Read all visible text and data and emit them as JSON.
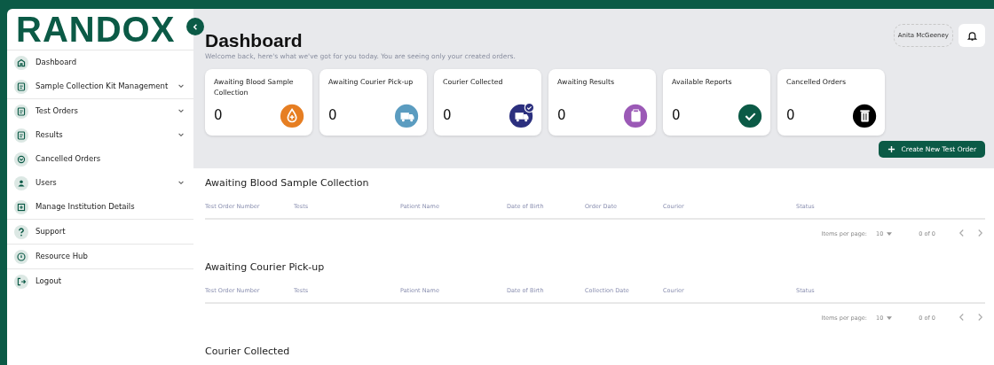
{
  "logo": {
    "text": "RANDOX"
  },
  "sidebar": {
    "items": [
      {
        "label": "Dashboard",
        "expandable": false,
        "divider": false
      },
      {
        "label": "Sample Collection Kit Management",
        "expandable": true,
        "divider": true
      },
      {
        "label": "Test Orders",
        "expandable": true,
        "divider": false
      },
      {
        "label": "Results",
        "expandable": true,
        "divider": false
      },
      {
        "label": "Cancelled Orders",
        "expandable": false,
        "divider": false
      },
      {
        "label": "Users",
        "expandable": true,
        "divider": false
      },
      {
        "label": "Manage Institution Details",
        "expandable": false,
        "divider": true
      },
      {
        "label": "Support",
        "expandable": false,
        "divider": true
      },
      {
        "label": "Resource Hub",
        "expandable": false,
        "divider": true
      },
      {
        "label": "Logout",
        "expandable": false,
        "divider": false
      }
    ]
  },
  "header": {
    "title": "Dashboard",
    "subtitle": "Welcome back, here's what we've got for you today. You are seeing only your created orders.",
    "user": "Anita McGeeney"
  },
  "cards": [
    {
      "label": "Awaiting Blood Sample Collection",
      "count": "0",
      "color": "#e67e22",
      "badge": false
    },
    {
      "label": "Awaiting Courier Pick-up",
      "count": "0",
      "color": "#5b9cc0",
      "badge": false
    },
    {
      "label": "Courier Collected",
      "count": "0",
      "color": "#2b2f7e",
      "badge": true
    },
    {
      "label": "Awaiting Results",
      "count": "0",
      "color": "#9b59b6",
      "badge": false
    },
    {
      "label": "Available Reports",
      "count": "0",
      "color": "#0b5a46",
      "badge": false
    },
    {
      "label": "Cancelled Orders",
      "count": "0",
      "color": "#000000",
      "badge": false
    }
  ],
  "create_button": {
    "label": "Create New Test Order"
  },
  "sections": [
    {
      "title": "Awaiting Blood Sample Collection",
      "columns": [
        "Test Order Number",
        "Tests",
        "Patient Name",
        "Date of Birth",
        "Order Date",
        "Courier",
        "Status"
      ],
      "pagination": {
        "label": "Items per page:",
        "size": "10",
        "range": "0 of 0"
      }
    },
    {
      "title": "Awaiting Courier Pick-up",
      "columns": [
        "Test Order Number",
        "Tests",
        "Patient Name",
        "Date of Birth",
        "Collection Date",
        "Courier",
        "Status"
      ],
      "pagination": {
        "label": "Items per page:",
        "size": "10",
        "range": "0 of 0"
      }
    },
    {
      "title": "Courier Collected"
    }
  ]
}
